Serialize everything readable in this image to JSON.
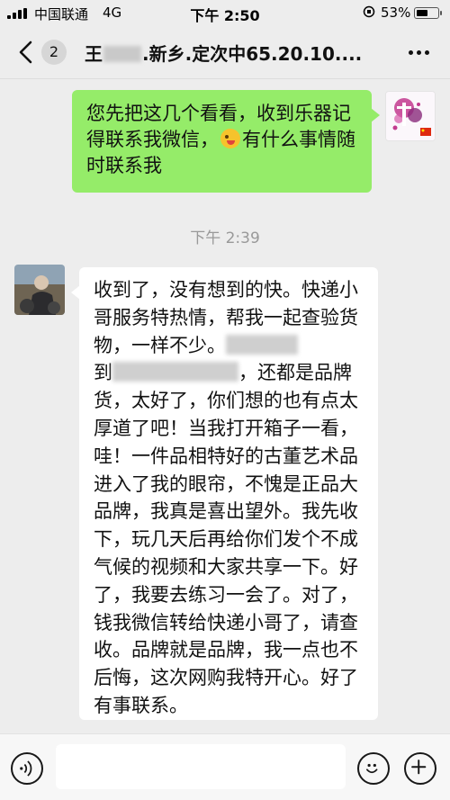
{
  "status_bar": {
    "carrier": "中国联通",
    "network": "4G",
    "time": "下午 2:50",
    "battery": "53%",
    "battery_level": 0.53
  },
  "header": {
    "unread_count": "2",
    "title_prefix": "王",
    "title_suffix": ".新乡.定次中65.20.10...."
  },
  "messages": [
    {
      "sender": "self",
      "parts": [
        "您先把这几个看看，收到乐器记得联系我微信，",
        "有什么事情随时联系我"
      ],
      "emoji": "grinning-tongue-emoji"
    },
    {
      "timestamp": "下午 2:39"
    },
    {
      "sender": "other",
      "text_start": "收到了，没有想到的快。快递小哥服务特热情，帮我一起查验货物，一样不少。",
      "text_line_start": "到",
      "text_end": "，还都是品牌货，太好了，你们想的也有点太厚道了吧！当我打开箱子一看，哇！一件品相特好的古董艺术品进入了我的眼帘，不愧是正品大品牌，我真是喜出望外。我先收下，玩几天后再给你们发个不成气候的视频和大家共享一下。好了，我要去练习一会了。对了，钱我微信转给快递小哥了，请查收。品牌就是品牌，我一点也不后悔，这次网购我特开心。好了有事联系。"
    }
  ],
  "colors": {
    "background": "#ededed",
    "outgoing_bubble": "#95ec69",
    "incoming_bubble": "#ffffff",
    "timestamp": "#999999"
  },
  "icons": [
    "back-chevron-icon",
    "more-dots-icon",
    "voice-icon",
    "emoji-icon",
    "plus-icon"
  ]
}
